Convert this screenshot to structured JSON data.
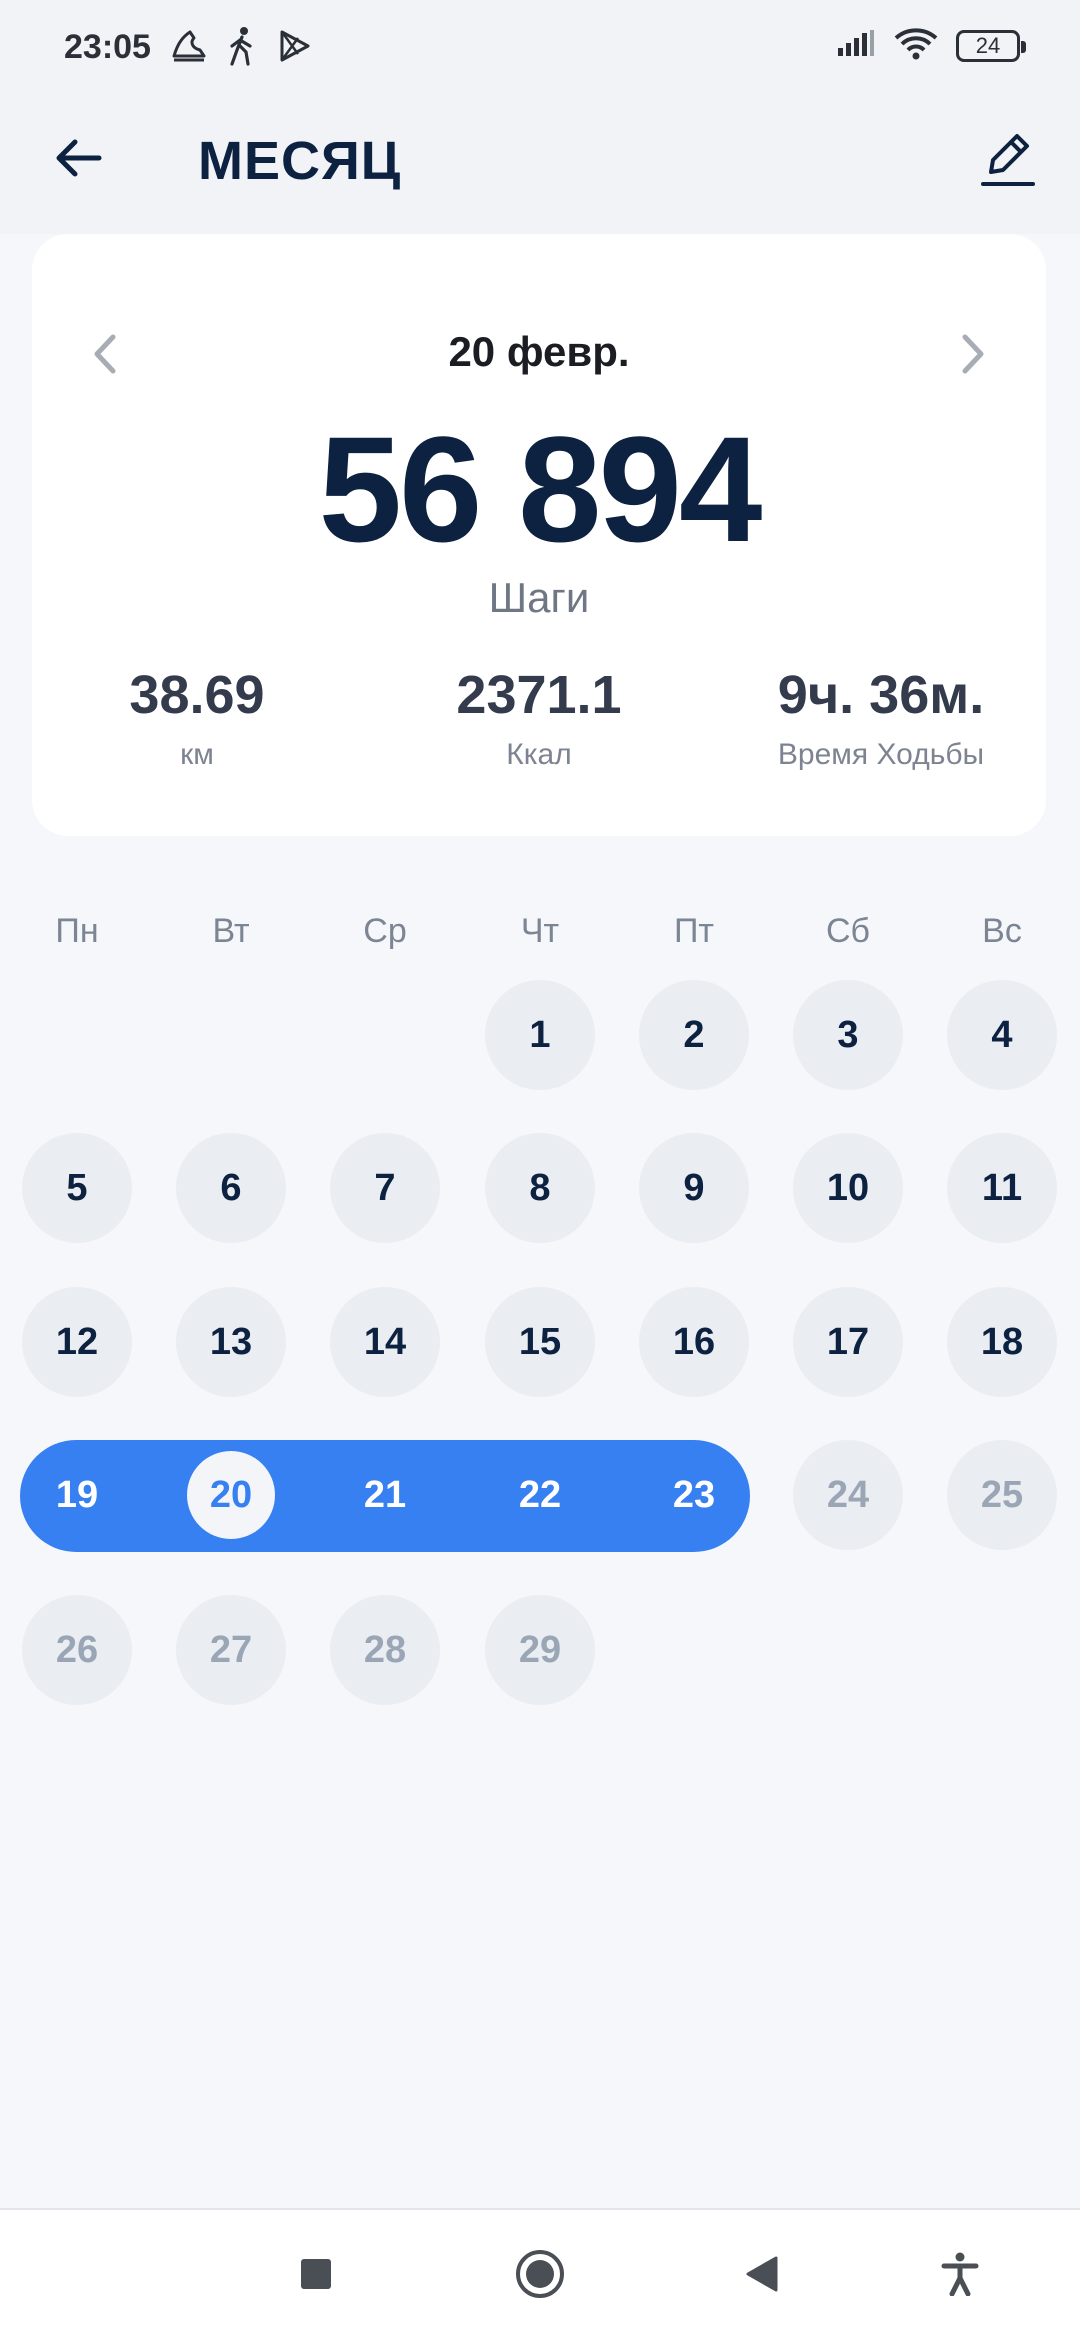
{
  "status_bar": {
    "time": "23:05",
    "left_icons": [
      "shoe-icon",
      "walking-person-icon",
      "play-store-icon"
    ],
    "right_icons": [
      "signal-icon",
      "wifi-icon",
      "battery-icon"
    ],
    "battery_level": "24"
  },
  "header": {
    "title": "МЕСЯЦ",
    "back_icon": "arrow-left-icon",
    "edit_icon": "pencil-icon"
  },
  "summary": {
    "date": "20 февр.",
    "steps": "56 894",
    "steps_label": "Шаги",
    "stats": [
      {
        "value": "38.69",
        "label": "км"
      },
      {
        "value": "2371.1",
        "label": "Ккал"
      },
      {
        "value": "9ч. 36м.",
        "label": "Время Ходьбы"
      }
    ]
  },
  "calendar": {
    "weekdays": [
      "Пн",
      "Вт",
      "Ср",
      "Чт",
      "Пт",
      "Сб",
      "Вс"
    ],
    "days": [
      "1",
      "2",
      "3",
      "4",
      "5",
      "6",
      "7",
      "8",
      "9",
      "10",
      "11",
      "12",
      "13",
      "14",
      "15",
      "16",
      "17",
      "18",
      "19",
      "20",
      "21",
      "22",
      "23",
      "24",
      "25",
      "26",
      "27",
      "28",
      "29"
    ],
    "selected_day": "20",
    "selected_week": [
      "19",
      "20",
      "21",
      "22",
      "23"
    ]
  },
  "colors": {
    "accent": "#3780f2",
    "title": "#0d2240",
    "day_bg": "#eaedf1",
    "future_text": "#9aa6b6"
  },
  "nav_bar": {
    "icons": [
      "square-icon",
      "home-circle-icon",
      "back-triangle-icon",
      "accessibility-icon"
    ]
  }
}
